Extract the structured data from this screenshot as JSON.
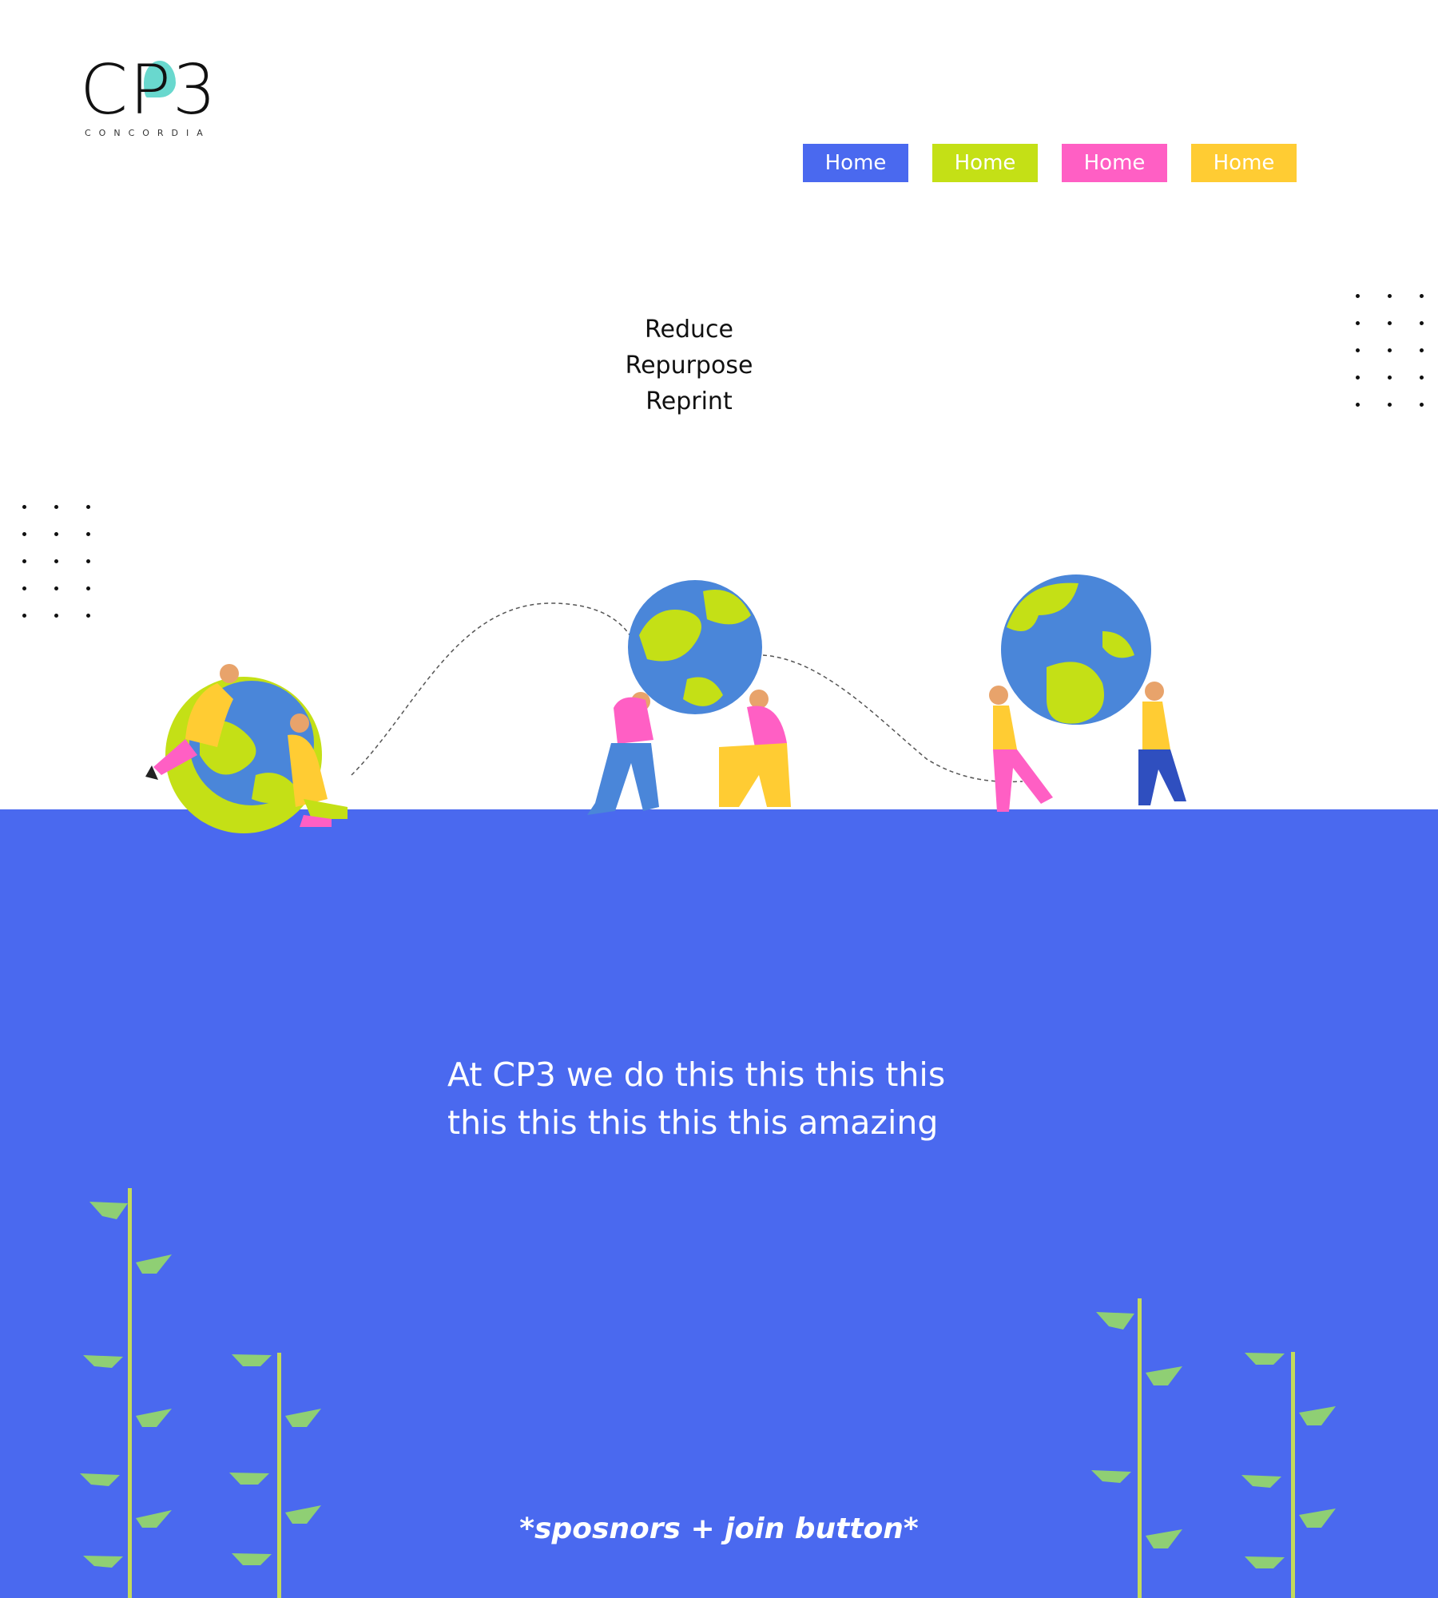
{
  "brand": {
    "logo_mark": "CP3",
    "logo_subtitle": "CONCORDIA"
  },
  "nav": {
    "items": [
      {
        "label": "Home",
        "color": "#4a69ef"
      },
      {
        "label": "Home",
        "color": "#c4e016"
      },
      {
        "label": "Home",
        "color": "#ff5fc4"
      },
      {
        "label": "Home",
        "color": "#ffcc33"
      }
    ]
  },
  "hero": {
    "taglines": [
      "Reduce",
      "Repurpose",
      "Reprint"
    ]
  },
  "mission": {
    "lines": [
      "At CP3 we do this this this this",
      "this this this this this amazing"
    ]
  },
  "footer": {
    "placeholder": "*sposnors + join button*"
  },
  "colors": {
    "band": "#4a69ef",
    "plant_stem": "#c3da5a",
    "plant_leaf": "#8fcf74"
  }
}
